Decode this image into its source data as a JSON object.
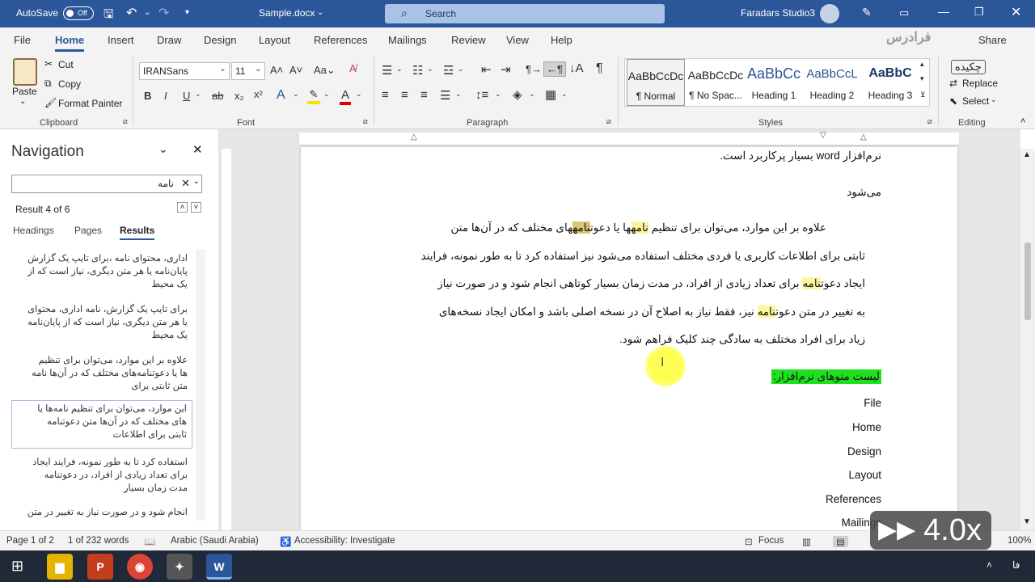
{
  "title_bar": {
    "autosave_label": "AutoSave",
    "autosave_state": "Off",
    "doc_name": "Sample.docx",
    "search_placeholder": "Search",
    "account_name": "Faradars Studio3"
  },
  "menu": {
    "tabs": [
      "File",
      "Home",
      "Insert",
      "Draw",
      "Design",
      "Layout",
      "References",
      "Mailings",
      "Review",
      "View",
      "Help"
    ],
    "active": "Home",
    "share_label": "Share"
  },
  "ribbon": {
    "clipboard": {
      "paste": "Paste",
      "cut": "Cut",
      "copy": "Copy",
      "format_painter": "Format Painter",
      "group": "Clipboard"
    },
    "font": {
      "name": "IRANSans",
      "size": "11",
      "group": "Font"
    },
    "paragraph": {
      "group": "Paragraph"
    },
    "styles": {
      "items": [
        {
          "preview": "AaBbCcDc",
          "name": "¶ Normal"
        },
        {
          "preview": "AaBbCcDc",
          "name": "¶ No Spac..."
        },
        {
          "preview": "AaBbCc",
          "name": "Heading 1"
        },
        {
          "preview": "AaBbCcL",
          "name": "Heading 2"
        },
        {
          "preview": "AaBbC",
          "name": "Heading 3"
        }
      ],
      "group": "Styles"
    },
    "editing": {
      "find": "چکیده",
      "replace": "Replace",
      "select": "Select",
      "group": "Editing"
    }
  },
  "navigation": {
    "title": "Navigation",
    "search_value": "نامه",
    "result_info": "Result 4 of 6",
    "tabs": [
      "Headings",
      "Pages",
      "Results"
    ],
    "active_tab": "Results",
    "results": [
      {
        "l1": "اداری، محتوای  نامه ،برای تایپ یک گزارش",
        "l2": "پایان‌نامه یا هر متن دیگری، نیاز است که از",
        "l3": "یک محیط"
      },
      {
        "l1": "برای تایپ یک گزارش، نامه اداری، محتوای",
        "l2": "یا هر متن دیگری، نیاز است که از  پایان‌نامه",
        "l3": "یک محیط"
      },
      {
        "l1": "علاوه بر این موارد، می‌توان برای تنظیم",
        "l2": "ها یا دعوتنامه‌های مختلف که در آن‌ها نامه",
        "l3": "متن ثابتی برای"
      },
      {
        "l1": "این موارد، می‌توان برای تنظیم نامه‌ها یا",
        "l2": "های مختلف که در آن‌ها متن دعوتنامه",
        "l3": "ثابتی برای اطلاعات"
      },
      {
        "l1": "استفاده کرد تا به طور نمونه، فرایند ایجاد",
        "l2": "برای تعداد زیادی از افراد، در  دعوتنامه",
        "l3": "مدت زمان بسیار"
      },
      {
        "l1": "انجام شود و در صورت نیاز به تغییر در متن",
        "l2": "",
        "l3": ""
      }
    ]
  },
  "document": {
    "line_top": "نرم‌افزار word بسیار پرکاربرد است.",
    "line_2": "می‌شود",
    "para": [
      "علاوه بر این موارد، می‌توان برای تنظیم نامه‌ها یا دعوتنامه‌های مختلف که در آن‌ها متن",
      "ثابتی برای اطلاعات کاربری یا فردی مختلف استفاده می‌شود نیز استفاده کرد تا به طور نمونه، فرایند",
      "ایجاد دعوتنامه برای تعداد زیادی از افراد، در مدت زمان بسیار کوتاهی انجام شود و در صورت نیاز",
      "به تغییر در متن دعوتنامه نیز، فقط نیاز به اصلاح آن در نسخه اصلی باشد و امکان ایجاد نسخه‌های",
      "زیاد برای افراد مختلف به سادگی چند کلیک فراهم شود."
    ],
    "list_heading": "لیست منوهای نرم‌افزار:",
    "list_items": [
      "File",
      "Home",
      "Design",
      "Layout",
      "References",
      "Mailings"
    ]
  },
  "status_bar": {
    "page": "Page 1 of 2",
    "words": "1 of 232 words",
    "language": "Arabic (Saudi Arabia)",
    "accessibility": "Accessibility: Investigate",
    "focus": "Focus",
    "zoom": "100%"
  },
  "overlay": {
    "speed": "4.0x",
    "watermark": "فرادرس"
  },
  "taskbar": {
    "lang": "فا"
  }
}
